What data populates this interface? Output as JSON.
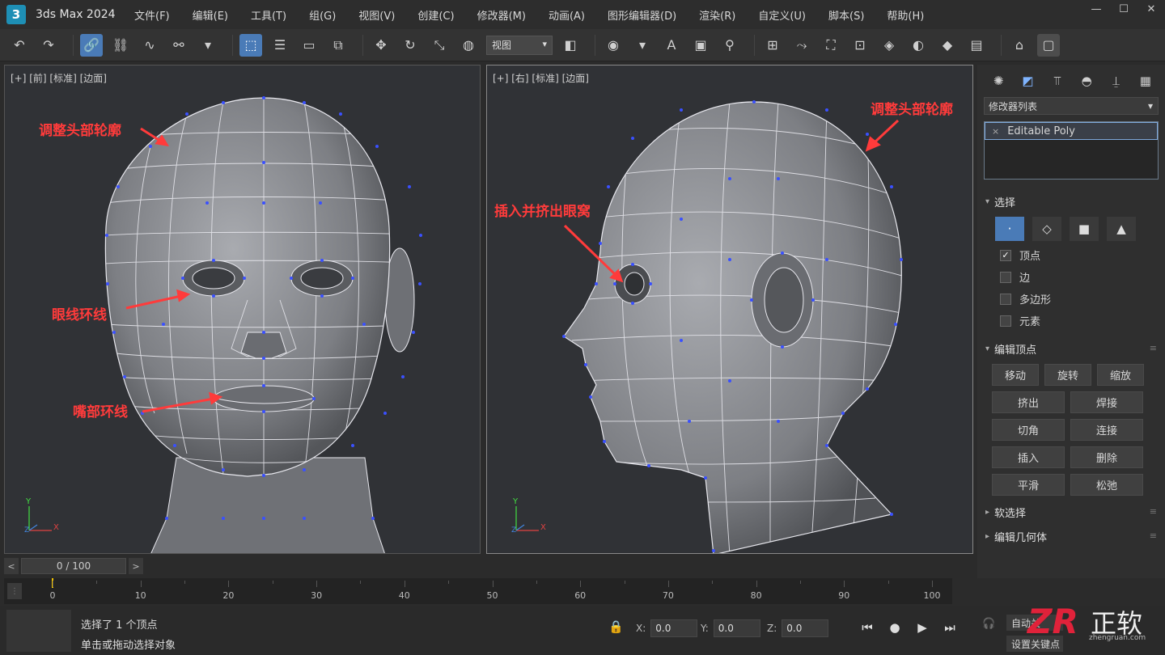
{
  "app": {
    "logo": "3",
    "title": "3ds Max 2024"
  },
  "menu": [
    "文件(F)",
    "编辑(E)",
    "工具(T)",
    "组(G)",
    "视图(V)",
    "创建(C)",
    "修改器(M)",
    "动画(A)",
    "图形编辑器(D)",
    "渲染(R)",
    "自定义(U)",
    "脚本(S)",
    "帮助(H)"
  ],
  "window_controls": {
    "minimize": "—",
    "maximize": "☐",
    "close": "✕"
  },
  "toolbar": {
    "view_dropdown": "视图"
  },
  "viewport_left": {
    "label": "[+] [前] [标准] [边面]",
    "annotations": {
      "head": "调整头部轮廓",
      "eye": "眼线环线",
      "mouth": "嘴部环线"
    },
    "axis": {
      "y": "Y",
      "x": "X",
      "z": "Z"
    }
  },
  "viewport_right": {
    "label": "[+] [右] [标准] [边面]",
    "annotations": {
      "head": "调整头部轮廓",
      "eye": "插入并挤出眼窝"
    },
    "axis": {
      "y": "Y",
      "x": "X",
      "z": "Z"
    }
  },
  "command_panel": {
    "modifier_list": "修改器列表",
    "stack_item": "Editable Poly",
    "stack_close": "×",
    "selection": {
      "title": "选择",
      "modes": [
        "·",
        "◇",
        "■",
        "▲"
      ],
      "options": [
        {
          "label": "顶点",
          "checked": true
        },
        {
          "label": "边",
          "checked": false
        },
        {
          "label": "多边形",
          "checked": false
        },
        {
          "label": "元素",
          "checked": false
        }
      ]
    },
    "edit_vertices": {
      "title": "编辑顶点",
      "row1": [
        "移动",
        "旋转",
        "缩放"
      ],
      "rows": [
        [
          "挤出",
          "焊接"
        ],
        [
          "切角",
          "连接"
        ],
        [
          "插入",
          "删除"
        ],
        [
          "平滑",
          "松弛"
        ]
      ]
    },
    "soft_selection": {
      "title": "软选择"
    },
    "edit_geometry": {
      "title": "编辑几何体"
    },
    "rollout_dots": "≡"
  },
  "timeline": {
    "slider_text": "0 / 100",
    "prev": "<",
    "next": ">",
    "ticks": [
      0,
      10,
      20,
      30,
      40,
      50,
      60,
      70,
      80,
      90,
      100
    ],
    "playhead": 0
  },
  "status": {
    "line1": "选择了 1 个顶点",
    "line2": "单击或拖动选择对象",
    "coords": {
      "x_label": "X:",
      "x": "0.0",
      "y_label": "Y:",
      "y": "0.0",
      "z_label": "Z:",
      "z": "0.0"
    },
    "auto_key": "自动关",
    "set_key": "设置关键点"
  },
  "watermark": {
    "logo": "ZR",
    "text": "正软",
    "url": "zhengruan.com"
  },
  "colors": {
    "annotation": "#ff3b3b",
    "accent": "#4a7bb7",
    "wire": "#e8e8ee",
    "vertex": "#3a50ff"
  }
}
